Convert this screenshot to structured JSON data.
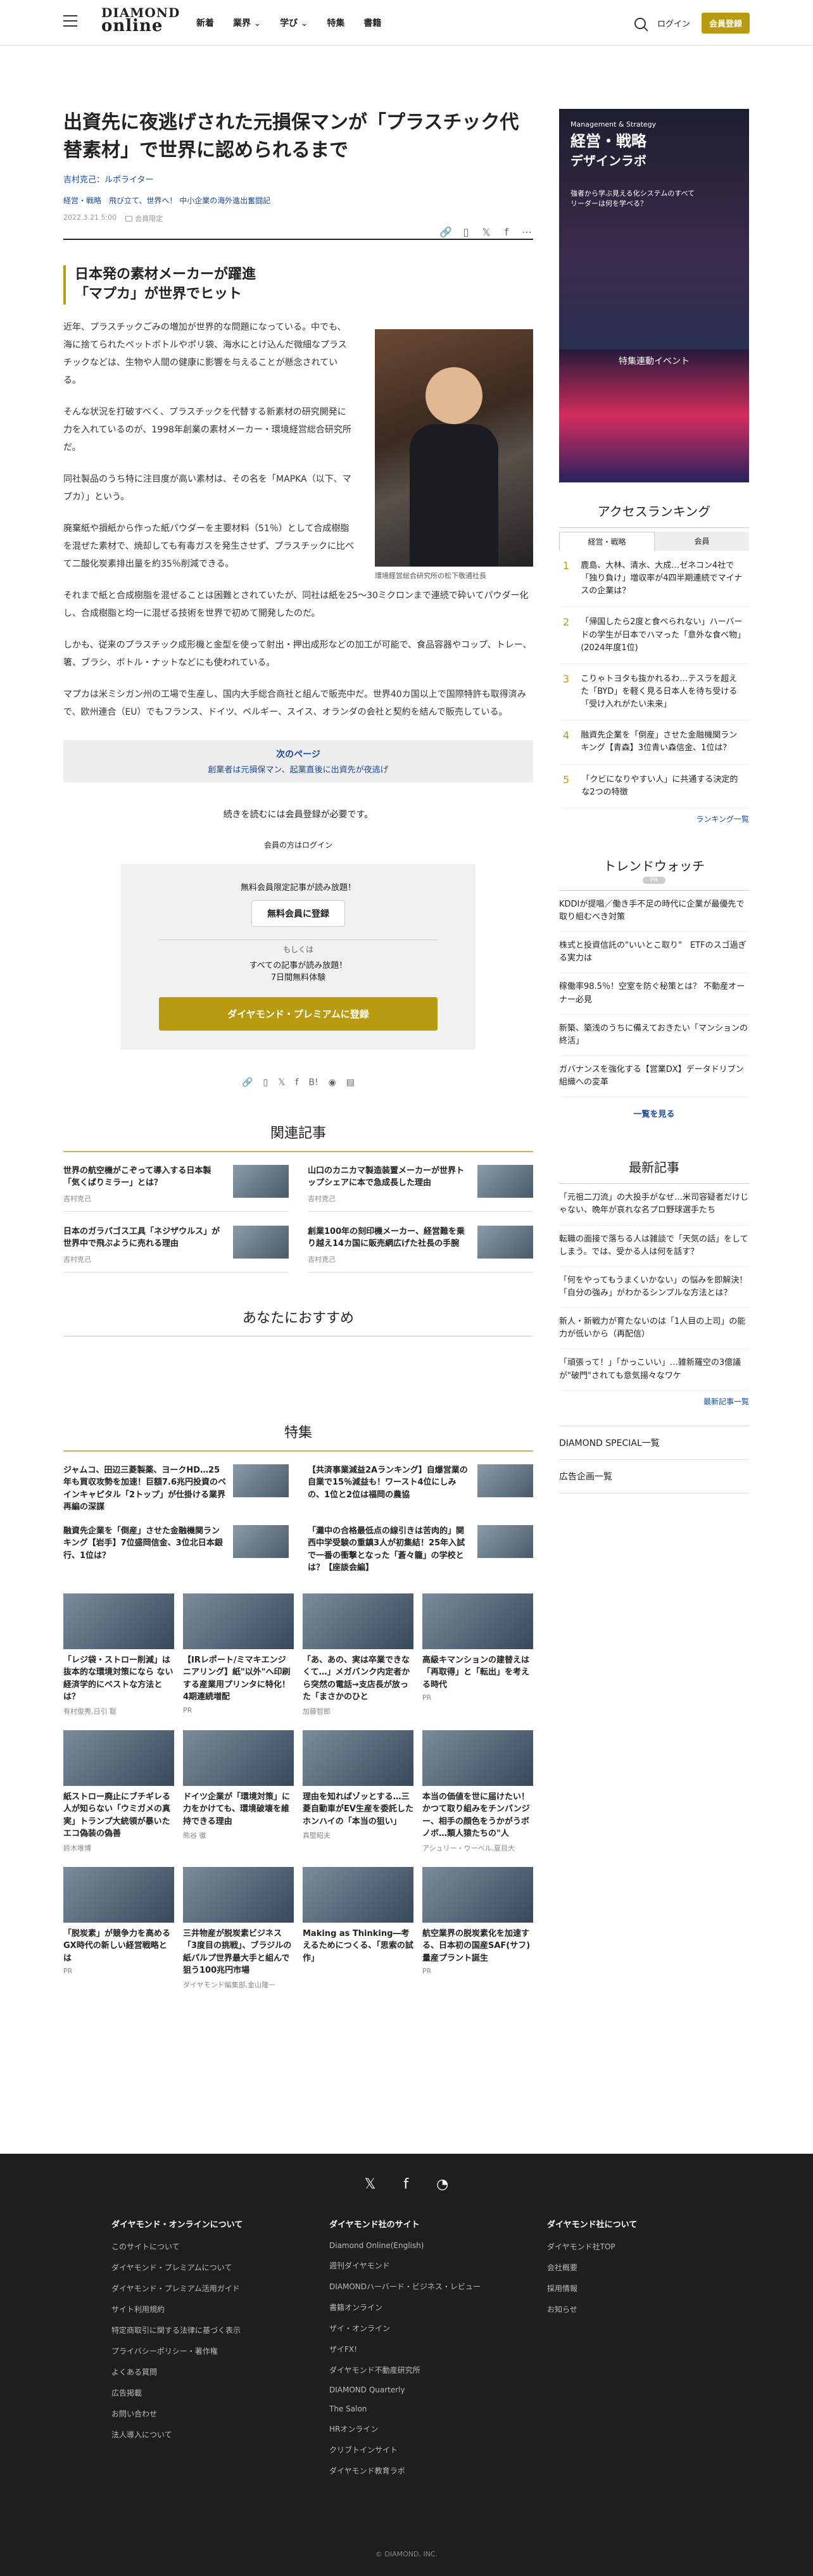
{
  "header": {
    "logo_line1": "DIAMOND",
    "logo_line2": "online",
    "nav": [
      "新着",
      "業界",
      "学び",
      "特集",
      "書籍"
    ],
    "login": "ログイン",
    "register": "会員登録"
  },
  "article": {
    "title": "出資先に夜逃げされた元損保マンが「プラスチック代替素材」で世界に認められるまで",
    "author": "吉村克己：ルポライター",
    "categories": "経営・戦略　飛び立て、世界へ！ 中小企業の海外進出奮闘記",
    "date": "2022.3.21 5:00",
    "member_label": "会員限定",
    "subheading": "日本発の素材メーカーが躍進\n「マプカ」が世界でヒット",
    "paragraphs": [
      "近年、プラスチックごみの増加が世界的な問題になっている。中でも、海に捨てられたペットボトルやポリ袋、海水にとけ込んだ微細なプラスチックなどは、生物や人間の健康に影響を与えることが懸念されている。",
      "そんな状況を打破すべく、プラスチックを代替する新素材の研究開発に力を入れているのが、1998年創業の素材メーカー・環境経営総合研究所だ。",
      "同社製品のうち特に注目度が高い素材は、その名を「MAPKA（以下、マプカ）」という。",
      "廃棄紙や損紙から作った紙パウダーを主要材料（51％）として合成樹脂を混ぜた素材で、焼却しても有毒ガスを発生させず、プラスチックに比べて二酸化炭素排出量を約35％削減できる。",
      "それまで紙と合成樹脂を混ぜることは困難とされていたが、同社は紙を25～30ミクロンまで連続で砕いてパウダー化し、合成樹脂と均一に混ぜる技術を世界で初めて開発したのだ。",
      "しかも、従来のプラスチック成形機と金型を使って射出・押出成形などの加工が可能で、食品容器やコップ、トレー、箸、ブラシ、ボトル・ナットなどにも使われている。",
      "マプカは米ミシガン州の工場で生産し、国内大手総合商社と組んで販売中だ。世界40カ国以上で国際特許も取得済みで、欧州連合（EU）でもフランス、ドイツ、ベルギー、スイス、オランダの会社と契約を結んで販売している。"
    ],
    "photo_caption": "環境経営総合研究所の松下敬通社長",
    "next_label": "次のページ",
    "next_title": "創業者は元損保マン、起業直後に出資先が夜逃げ",
    "continue_msg": "続きを読むには会員登録が必要です。",
    "login_msg": "会員の方はログイン"
  },
  "regbox": {
    "head": "無料会員限定記事が読み放題！",
    "free_btn": "無料会員に登録",
    "or": "もしくは",
    "desc1": "すべての記事が読み放題！",
    "desc2": "7日間無料体験",
    "premium_btn": "ダイヤモンド・プレミアムに登録"
  },
  "related": {
    "title": "関連記事",
    "items": [
      {
        "t": "世界の航空機がこぞって導入する日本製「気くばりミラー」とは？",
        "a": "吉村克己"
      },
      {
        "t": "山口のカニカマ製造装置メーカーが世界トップシェアに本で急成長した理由",
        "a": "吉村克己"
      },
      {
        "t": "日本のガラパゴス工具「ネジザウルス」が世界中で飛ぶように売れる理由",
        "a": "吉村克己"
      },
      {
        "t": "創業100年の刻印機メーカー、経営難を乗り越え14カ国に販売網広げた社長の手腕",
        "a": "吉村克己"
      }
    ]
  },
  "recommend_title": "あなたにおすすめ",
  "feature": {
    "title": "特集",
    "items": [
      {
        "t": "ジャムコ、田辺三菱製薬、ヨークHD…25年も買収攻勢を加速！巨額7.6兆円投資のベインキャピタル「2トップ」が仕掛ける業界再編の深謀"
      },
      {
        "t": "【共済事業減益2Aランキング】自爆営業の自業で15％減益も！ワースト4位にしみの、1位と2位は福岡の農協"
      },
      {
        "t": "融資先企業を「倒産」させた金融機関ランキング【岩手】7位盛岡信金、3位北日本銀行、1位は？"
      },
      {
        "t": "「灘中の合格最低点の線引きは苦肉的」関西中学受験の重鎮3人が初集結！25年入試で一番の衝撃となった「蒼々籠」の学校とは？【座談会編】"
      }
    ]
  },
  "grid": [
    {
      "t": "「レジ袋・ストロー削減」は抜本的な環境対策になら ない経済学的にベストな方法とは？",
      "a": "有村俊秀,日引 聡"
    },
    {
      "t": "【IRレポート/ミマキエンジニアリング】紙\"以外\"へ印刷する産業用プリンタに特化！4期連続増配",
      "a": "PR"
    },
    {
      "t": "「あ、あの、実は卒業できなくて…」メガバンク内定者から突然の電話→支店長が放った「まさかのひと",
      "a": "加藤哲郎"
    },
    {
      "t": "高級キマンションの建替えは「再取得」と「転出」を考える時代",
      "a": "PR"
    },
    {
      "t": "紙ストロー廃止にブチギレる人が知らない「ウミガメの真実」トランプ大統領が暴いたエコ偽装の偽善",
      "a": "鈴木唯博"
    },
    {
      "t": "ドイツ企業が「環境対策」に力をかけても、環境破壊を維持できる理由",
      "a": "熊谷 徹"
    },
    {
      "t": "理由を知ればゾッとする…三菱自動車がEV生産を委託したホンハイの「本当の狙い」",
      "a": "真壁昭夫"
    },
    {
      "t": "本当の価値を世に届けたい！かつて取り組みをチンパンジー、相手の顔色をうかがうボノボ…類人猿たちの\"人",
      "a": "アシュリー・ウーベル,夏目大"
    },
    {
      "t": "「脱炭素」が競争力を高めるGX時代の新しい経営戦略とは",
      "a": "PR"
    },
    {
      "t": "三井物産が脱炭素ビジネス「3度目の挑戦」、ブラジルの紙パルプ世界最大手と組んで狙う100兆円市場",
      "a": "ダイヤモンド編集部,金山隆一"
    },
    {
      "t": "Making as Thinking―考えるためにつくる、「思索の試作」",
      "a": ""
    },
    {
      "t": "航空業界の脱炭素化を加速する、日本初の国産SAF(サフ)量産プラント誕生",
      "a": "PR"
    }
  ],
  "side": {
    "ad_title": "経営・戦略",
    "ad_sub": "Management & Strategy",
    "ad_label": "デザインラボ",
    "ad_note": "強者から学ぶ見える化システムのすべて\nリーダーは何を学べる？",
    "ad2_label": "特集連動イベント",
    "rank_title": "アクセスランキング",
    "tabs": [
      "経営・戦略",
      "会員"
    ],
    "ranking": [
      "鹿島、大林、清水、大成…ゼネコン4社で「独り負け」増収率が4四半期連続でマイナスの企業は？",
      "「帰国したら2度と食べられない」ハーバードの学生が日本でハマった「意外な食べ物」(2024年度1位)",
      "こりゃトヨタも抜かれるわ…テスラを超えた「BYD」を軽く見る日本人を待ち受ける「受け入れがたい未来」",
      "融資先企業を「倒産」させた金融機関ランキング【青森】3位青い森信金、1位は？",
      "「クビになりやすい人」に共通する決定的な2つの特徴"
    ],
    "rank_more": "ランキング一覧",
    "trend_title": "トレンドウォッチ",
    "trend_badge": "PR",
    "trends": [
      "KDDIが提唱／働き手不足の時代に企業が最優先で取り組むべき対策",
      "株式と投資信託の\"いいとこ取り\"　ETFのスゴ過ぎる実力は",
      "稼働率98.5％！空室を防ぐ秘策とは？ 不動産オーナー必見",
      "新築、築浅のうちに備えておきたい「マンションの終活」",
      "ガバナンスを強化する【営業DX】データドリブン組織への変革"
    ],
    "trend_more": "一覧を見る",
    "latest_title": "最新記事",
    "latest": [
      "「元祖二刀流」の大投手がなぜ…米司容疑者だけじゃない、晩年が哀れな名プロ野球選手たち",
      "転職の面接で落ちる人は雑談で「天気の話」をしてしまう。では、受かる人は何を話す？",
      "「何をやってもうまくいかない」の悩みを即解決！「自分の強み」がわかるシンプルな方法とは？",
      "新人・新戦力が育たないのは「1人目の上司」の能力が低いから（再配信）",
      "「頑張って！」「かっこいい」…雑新羅空の3億議が\"破門\"されても意気揚々なワケ"
    ],
    "latest_more": "最新記事一覧",
    "links": [
      "DIAMOND SPECIAL一覧",
      "広告企画一覧"
    ]
  },
  "footer": {
    "col1": {
      "h": "ダイヤモンド・オンラインについて",
      "links": [
        "このサイトについて",
        "ダイヤモンド・プレミアムについて",
        "ダイヤモンド・プレミアム活用ガイド",
        "サイト利用規約",
        "特定商取引に関する法律に基づく表示",
        "プライバシーポリシー・著作権",
        "よくある質問",
        "広告掲載",
        "お問い合わせ",
        "法人導入について"
      ]
    },
    "col2": {
      "h": "ダイヤモンド社のサイト",
      "links": [
        "Diamond Online(English)",
        "週刊ダイヤモンド",
        "DIAMONDハーバード・ビジネス・レビュー",
        "書籍オンライン",
        "ザイ・オンライン",
        "ザイFX!",
        "ダイヤモンド不動産研究所",
        "DIAMOND Quarterly",
        "The Salon",
        "HRオンライン",
        "クリブトインサイト",
        "ダイヤモンド教育ラボ"
      ]
    },
    "col3": {
      "h": "ダイヤモンド社について",
      "links": [
        "ダイヤモンド社TOP",
        "会社概要",
        "採用情報",
        "お知らせ"
      ]
    },
    "copyright": "© DIAMOND, INC."
  }
}
